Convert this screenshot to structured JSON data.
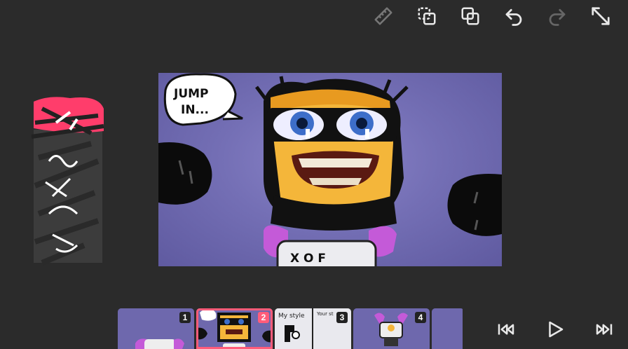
{
  "toolbar": {
    "icons": [
      "ruler-icon",
      "duplicate-icon",
      "layers-icon",
      "undo-icon",
      "redo-icon",
      "expand-icon"
    ]
  },
  "canvas": {
    "speech_bubble_line1": "JUMP",
    "speech_bubble_line2": "IN...",
    "belly_text": "X O F"
  },
  "timeline": {
    "frames": [
      {
        "number": "1",
        "label_a": "",
        "label_b": ""
      },
      {
        "number": "2",
        "label_a": "",
        "label_b": ""
      },
      {
        "number": "3",
        "label_a": "My style",
        "label_b": "Your st"
      },
      {
        "number": "4",
        "label_a": "",
        "label_b": ""
      }
    ],
    "selected_index": 1
  },
  "colors": {
    "background": "#2b2b2b",
    "canvas_purple": "#746fb5",
    "accent_pink": "#ff5c7a",
    "icon_gray": "#e8e8e8",
    "icon_disabled": "#777777"
  }
}
